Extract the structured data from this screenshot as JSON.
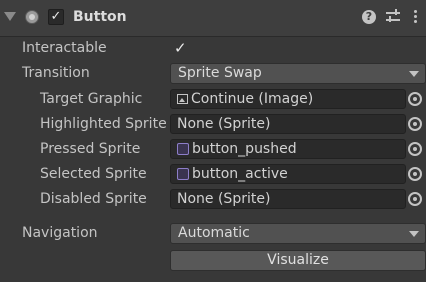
{
  "component": {
    "title": "Button",
    "enabled": true
  },
  "header_icons": {
    "help": "?",
    "preset": "preset-icon",
    "menu": "kebab-menu-icon"
  },
  "fields": {
    "interactable": {
      "label": "Interactable",
      "checked": true,
      "check_glyph": "✓"
    },
    "transition": {
      "label": "Transition",
      "value": "Sprite Swap"
    },
    "target_graphic": {
      "label": "Target Graphic",
      "value": "Continue (Image)"
    },
    "highlighted_sprite": {
      "label": "Highlighted Sprite",
      "value": "None (Sprite)"
    },
    "pressed_sprite": {
      "label": "Pressed Sprite",
      "value": "button_pushed"
    },
    "selected_sprite": {
      "label": "Selected Sprite",
      "value": "button_active"
    },
    "disabled_sprite": {
      "label": "Disabled Sprite",
      "value": "None (Sprite)"
    },
    "navigation": {
      "label": "Navigation",
      "value": "Automatic"
    }
  },
  "visualize_button": {
    "label": "Visualize"
  },
  "colors": {
    "background": "#383838",
    "header": "#3e3e3e",
    "field": "#2a2a2a",
    "dropdown": "#515151",
    "text": "#c4c4c4"
  }
}
